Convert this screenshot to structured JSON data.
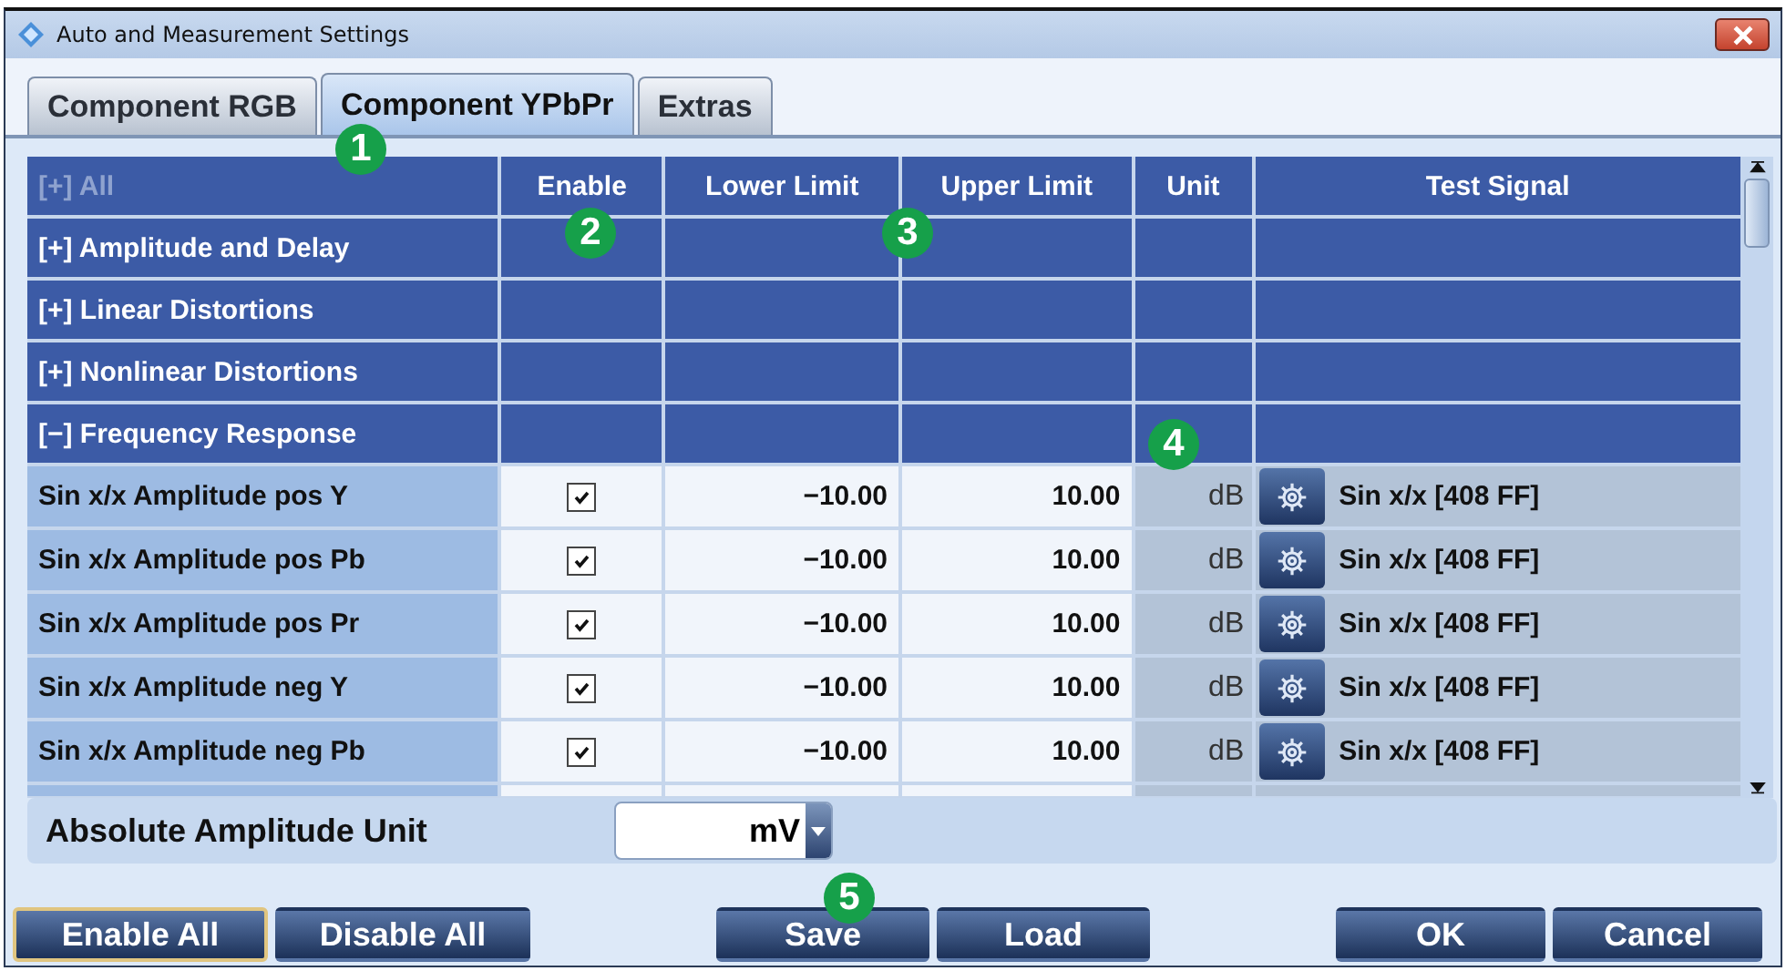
{
  "window": {
    "title": "Auto and Measurement Settings"
  },
  "tabs": [
    {
      "label": "Component RGB",
      "selected": false
    },
    {
      "label": "Component YPbPr",
      "selected": true
    },
    {
      "label": "Extras",
      "selected": false
    }
  ],
  "table": {
    "all_toggle": {
      "text": "[+] All",
      "disabled": true
    },
    "columns": [
      "Enable",
      "Lower Limit",
      "Upper Limit",
      "Unit",
      "Test Signal"
    ],
    "rows": [
      {
        "kind": "group",
        "toggle": "[+]",
        "label": "Amplitude and Delay"
      },
      {
        "kind": "group",
        "toggle": "[+]",
        "label": "Linear Distortions"
      },
      {
        "kind": "group",
        "toggle": "[+]",
        "label": "Nonlinear Distortions"
      },
      {
        "kind": "group",
        "toggle": "[−]",
        "label": "Frequency Response"
      },
      {
        "kind": "item",
        "name": "Sin x/x Amplitude pos Y",
        "enabled": true,
        "lower": "−10.00",
        "upper": "10.00",
        "unit": "dB",
        "test_signal": "Sin x/x [408 FF]"
      },
      {
        "kind": "item",
        "name": "Sin x/x Amplitude pos Pb",
        "enabled": true,
        "lower": "−10.00",
        "upper": "10.00",
        "unit": "dB",
        "test_signal": "Sin x/x [408 FF]"
      },
      {
        "kind": "item",
        "name": "Sin x/x Amplitude pos Pr",
        "enabled": true,
        "lower": "−10.00",
        "upper": "10.00",
        "unit": "dB",
        "test_signal": "Sin x/x [408 FF]"
      },
      {
        "kind": "item",
        "name": "Sin x/x Amplitude neg Y",
        "enabled": true,
        "lower": "−10.00",
        "upper": "10.00",
        "unit": "dB",
        "test_signal": "Sin x/x [408 FF]"
      },
      {
        "kind": "item",
        "name": "Sin x/x Amplitude neg Pb",
        "enabled": true,
        "lower": "−10.00",
        "upper": "10.00",
        "unit": "dB",
        "test_signal": "Sin x/x [408 FF]"
      }
    ]
  },
  "unit_setting": {
    "label": "Absolute Amplitude Unit",
    "value": "mV"
  },
  "button_groups": [
    [
      {
        "label": "Enable All",
        "focused": true
      },
      {
        "label": "Disable All",
        "focused": false
      }
    ],
    [
      {
        "label": "Save",
        "focused": false
      },
      {
        "label": "Load",
        "focused": false
      }
    ],
    [
      {
        "label": "OK",
        "focused": false
      },
      {
        "label": "Cancel",
        "focused": false
      }
    ]
  ],
  "callouts": [
    "1",
    "2",
    "3",
    "4",
    "5"
  ]
}
